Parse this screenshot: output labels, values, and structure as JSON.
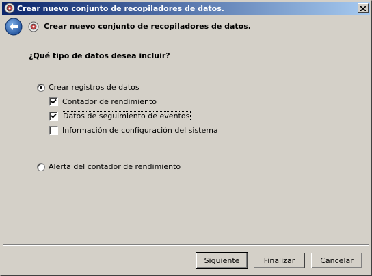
{
  "window": {
    "title": "Crear nuevo conjunto de recopiladores de datos."
  },
  "header": {
    "title": "Crear nuevo conjunto de recopiladores de datos."
  },
  "main": {
    "question": "¿Qué tipo de datos desea incluir?",
    "options": {
      "create_logs": {
        "label": "Crear registros de datos",
        "selected": true
      },
      "perf_counter": {
        "label": "Contador de rendimiento",
        "checked": true
      },
      "event_trace": {
        "label": "Datos de seguimiento de eventos",
        "checked": true
      },
      "sys_config": {
        "label": "Información de configuración del sistema",
        "checked": false
      },
      "perf_alert": {
        "label": "Alerta del contador de rendimiento",
        "selected": false
      }
    }
  },
  "footer": {
    "next_label": "Siguiente",
    "finish_label": "Finalizar",
    "cancel_label": "Cancelar"
  },
  "colors": {
    "titlebar_start": "#0a246a",
    "titlebar_end": "#a6caf0",
    "face": "#d4d0c8"
  }
}
